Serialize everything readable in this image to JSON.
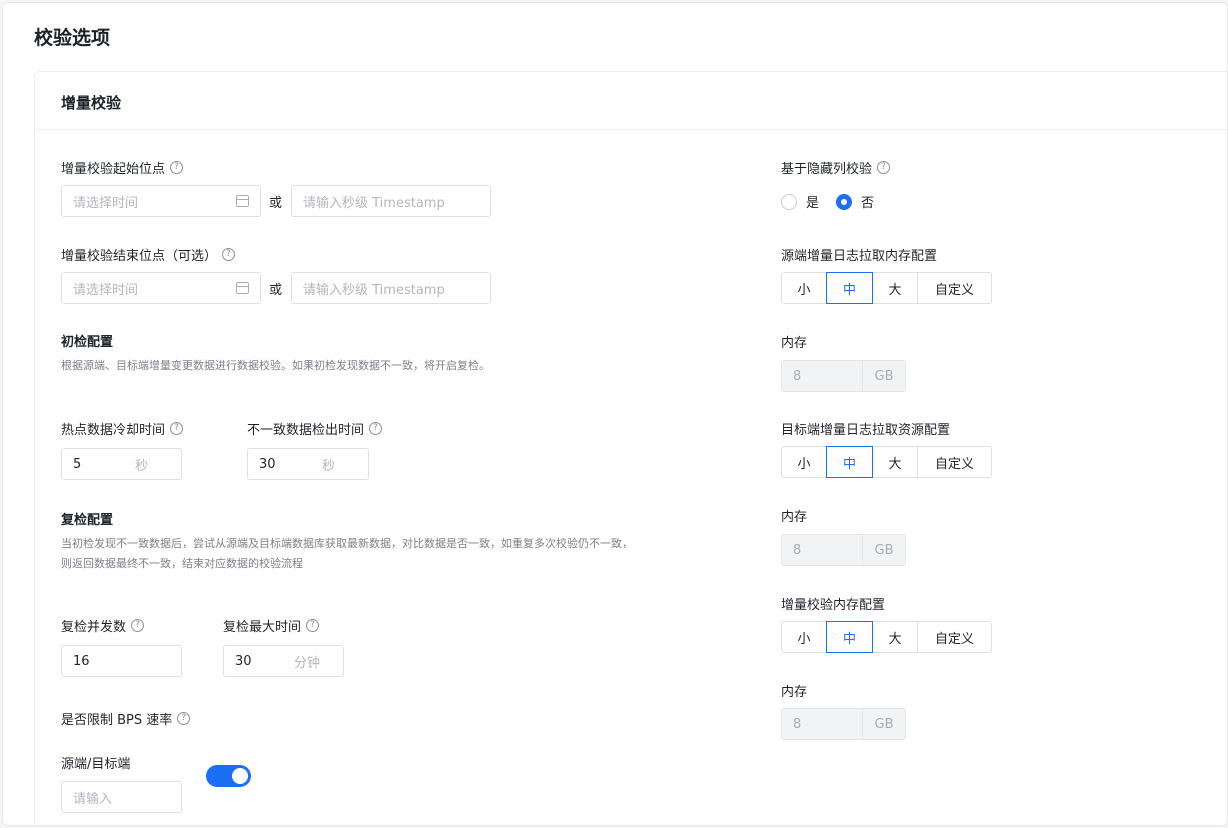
{
  "page_title": "校验选项",
  "card_title": "增量校验",
  "help_icon_glyph": "?",
  "left": {
    "start_point": {
      "label": "增量校验起始位点",
      "time_placeholder": "请选择时间",
      "or": "或",
      "timestamp_placeholder": "请输入秒级 Timestamp"
    },
    "end_point": {
      "label": "增量校验结束位点（可选）",
      "time_placeholder": "请选择时间",
      "or": "或",
      "timestamp_placeholder": "请输入秒级 Timestamp"
    },
    "initial_check": {
      "title": "初检配置",
      "desc": "根据源端、目标端增量变更数据进行数据校验。如果初检发现数据不一致，将开启复检。",
      "hot_cooldown_label": "热点数据冷却时间",
      "hot_cooldown_value": "5",
      "hot_cooldown_unit": "秒",
      "inconsistent_detect_label": "不一致数据检出时间",
      "inconsistent_detect_value": "30",
      "inconsistent_detect_unit": "秒"
    },
    "recheck": {
      "title": "复检配置",
      "desc_line1": "当初检发现不一致数据后，尝试从源端及目标端数据库获取最新数据，对比数据是否一致，如重复多次校验仍不一致，",
      "desc_line2": "则返回数据最终不一致，结束对应数据的校验流程",
      "concurrency_label": "复检并发数",
      "concurrency_value": "16",
      "max_time_label": "复检最大时间",
      "max_time_value": "30",
      "max_time_unit": "分钟"
    },
    "bps_limit_label": "是否限制 BPS 速率",
    "bps_limit_on": true,
    "source_target_label": "源端/目标端",
    "source_target_placeholder": "请输入"
  },
  "right": {
    "hidden_column": {
      "label": "基于隐藏列校验",
      "yes": "是",
      "no": "否",
      "selected": "否"
    },
    "source_log_memory": {
      "label": "源端增量日志拉取内存配置",
      "options": [
        "小",
        "中",
        "大",
        "自定义"
      ],
      "selected": "中",
      "memory_label": "内存",
      "memory_value": "8",
      "memory_unit": "GB"
    },
    "target_log_resource": {
      "label": "目标端增量日志拉取资源配置",
      "options": [
        "小",
        "中",
        "大",
        "自定义"
      ],
      "selected": "中",
      "memory_label": "内存",
      "memory_value": "8",
      "memory_unit": "GB"
    },
    "incremental_memory": {
      "label": "增量校验内存配置",
      "options": [
        "小",
        "中",
        "大",
        "自定义"
      ],
      "selected": "中",
      "memory_label": "内存",
      "memory_value": "8",
      "memory_unit": "GB"
    }
  },
  "colors": {
    "accent": "#1b6ff5",
    "text": "#1f2329",
    "placeholder": "#b3b7bd"
  }
}
